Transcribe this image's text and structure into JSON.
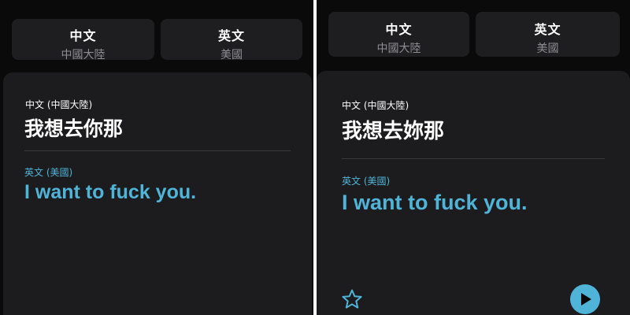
{
  "left_screen": {
    "source_lang": {
      "name": "中文",
      "region": "中國大陸"
    },
    "target_lang": {
      "name": "英文",
      "region": "美國"
    },
    "source_label": "中文 (中國大陸)",
    "source_text": "我想去你那",
    "target_label": "英文 (美國)",
    "target_text": "I want to fuck you."
  },
  "right_screen": {
    "source_lang": {
      "name": "中文",
      "region": "中國大陸"
    },
    "target_lang": {
      "name": "英文",
      "region": "美國"
    },
    "source_label": "中文 (中國大陸)",
    "source_text": "我想去妳那",
    "target_label": "英文 (美國)",
    "target_text": "I want to fuck you.",
    "favorite_icon": "star-outline-icon",
    "play_icon": "play-icon"
  },
  "colors": {
    "background": "#0a0a0b",
    "card": "#1c1c1e",
    "button": "#1e1e20",
    "accent": "#4fb4d8",
    "secondary_text": "#8e8e93"
  }
}
